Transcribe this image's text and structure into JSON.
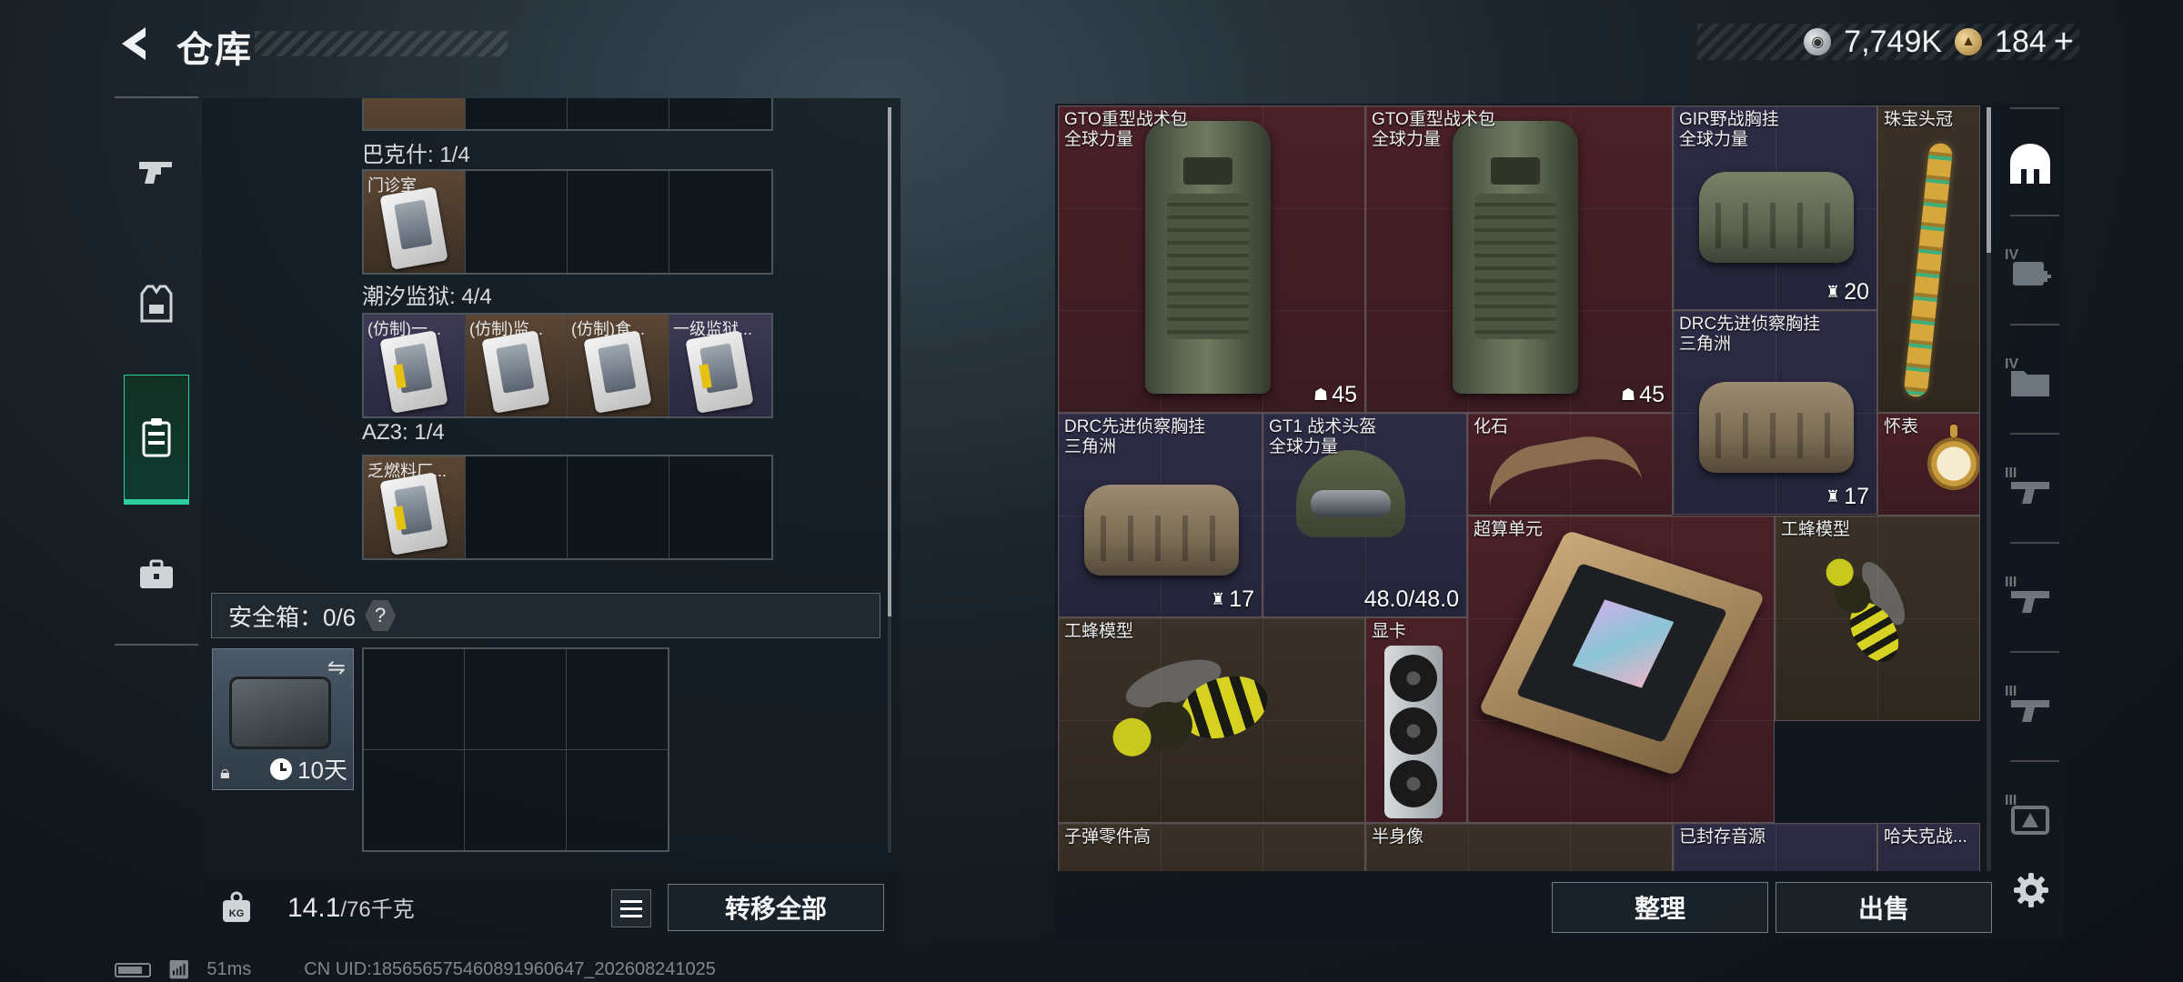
{
  "header": {
    "title": "仓库",
    "currencies": [
      {
        "icon": "silver-coin-icon",
        "value": "7,749K"
      },
      {
        "icon": "gold-coin-icon",
        "value": "184"
      }
    ],
    "add_label": "+"
  },
  "left_nav": {
    "items": [
      {
        "id": "weapons",
        "icon": "pistol-icon",
        "active": false
      },
      {
        "id": "equipment",
        "icon": "vest-icon",
        "active": false
      },
      {
        "id": "cards",
        "icon": "card-holder-icon",
        "active": true
      },
      {
        "id": "items",
        "icon": "briefcase-icon",
        "active": false
      }
    ]
  },
  "key_sections": [
    {
      "label": "巴克什: 1/4",
      "cells": [
        {
          "name": "门诊室",
          "color": "brown"
        }
      ]
    },
    {
      "label": "潮汐监狱: 4/4",
      "cells": [
        {
          "name": "(仿制)一...",
          "color": "purple"
        },
        {
          "name": "(仿制)监...",
          "color": "brown"
        },
        {
          "name": "(仿制)食...",
          "color": "brown"
        },
        {
          "name": "一级监狱...",
          "color": "purple"
        }
      ]
    },
    {
      "label": "AZ3: 1/4",
      "cells": [
        {
          "name": "乏燃料厂...",
          "color": "brown"
        }
      ]
    }
  ],
  "safebox": {
    "label": "安全箱：0/6",
    "help": "?",
    "days": "10天"
  },
  "weight": {
    "current": "14.1",
    "max": "/76千克",
    "icon_text": "KG"
  },
  "buttons": {
    "transfer_all": "转移全部",
    "sort": "整理",
    "sell": "出售"
  },
  "status": {
    "ping": "51ms",
    "uid": "CN UID:1856565754608919606​47_202608241025"
  },
  "stash": {
    "items": [
      {
        "name": "GTO重型战术包\n全球力量",
        "qty": "45",
        "qty_icon": "durability-icon",
        "color": "red",
        "art": "backpack"
      },
      {
        "name": "GTO重型战术包\n全球力量",
        "qty": "45",
        "qty_icon": "durability-icon",
        "color": "red",
        "art": "backpack"
      },
      {
        "name": "GIR野战胸挂\n全球力量",
        "qty": "20",
        "qty_icon": "armor-icon",
        "color": "purple",
        "art": "vest"
      },
      {
        "name": "珠宝头冠",
        "qty": "",
        "color": "brown",
        "art": "crown"
      },
      {
        "name": "DRC先进侦察胸挂\n三角洲",
        "qty": "17",
        "qty_icon": "armor-icon",
        "color": "purple",
        "art": "vest-tan"
      },
      {
        "name": "DRC先进侦察胸挂\n三角洲",
        "qty": "17",
        "qty_icon": "armor-icon",
        "color": "purple",
        "art": "vest-tan"
      },
      {
        "name": "GT1 战术头盔\n全球力量",
        "qty": "48.0/48.0",
        "color": "purple",
        "art": "helmet"
      },
      {
        "name": "化石",
        "qty": "",
        "color": "red",
        "art": "fossil"
      },
      {
        "name": "怀表",
        "qty": "",
        "color": "red",
        "art": "watch"
      },
      {
        "name": "超算单元",
        "qty": "",
        "color": "red",
        "art": "board"
      },
      {
        "name": "工蜂模型",
        "qty": "",
        "color": "brown",
        "art": "wasp"
      },
      {
        "name": "工蜂模型",
        "qty": "",
        "color": "brown",
        "art": "wasp"
      },
      {
        "name": "显卡",
        "qty": "",
        "color": "red",
        "art": "gpu"
      },
      {
        "name": "子弹零件高",
        "qty": "",
        "color": "brown",
        "art": "none"
      },
      {
        "name": "半身像",
        "qty": "",
        "color": "brown",
        "art": "none"
      },
      {
        "name": "已封存音源",
        "qty": "",
        "color": "purple",
        "art": "none"
      },
      {
        "name": "哈夫克战...",
        "qty": "",
        "color": "purple",
        "art": "none"
      }
    ]
  },
  "right_tabs": [
    {
      "icon": "stash-home-icon",
      "tier": ""
    },
    {
      "icon": "expand-case-icon",
      "tier": "IV"
    },
    {
      "icon": "folder-icon",
      "tier": "IV"
    },
    {
      "icon": "rifle-rack-icon",
      "tier": "III"
    },
    {
      "icon": "rifle-rack-icon",
      "tier": "III"
    },
    {
      "icon": "rifle-rack-icon",
      "tier": "III"
    },
    {
      "icon": "triangle-case-icon",
      "tier": "III"
    }
  ],
  "colors": {
    "accent": "#2fcf9d",
    "red_rarity": "#4a2027",
    "purple_rarity": "#2e2c45",
    "brown_rarity": "#3a3128"
  }
}
